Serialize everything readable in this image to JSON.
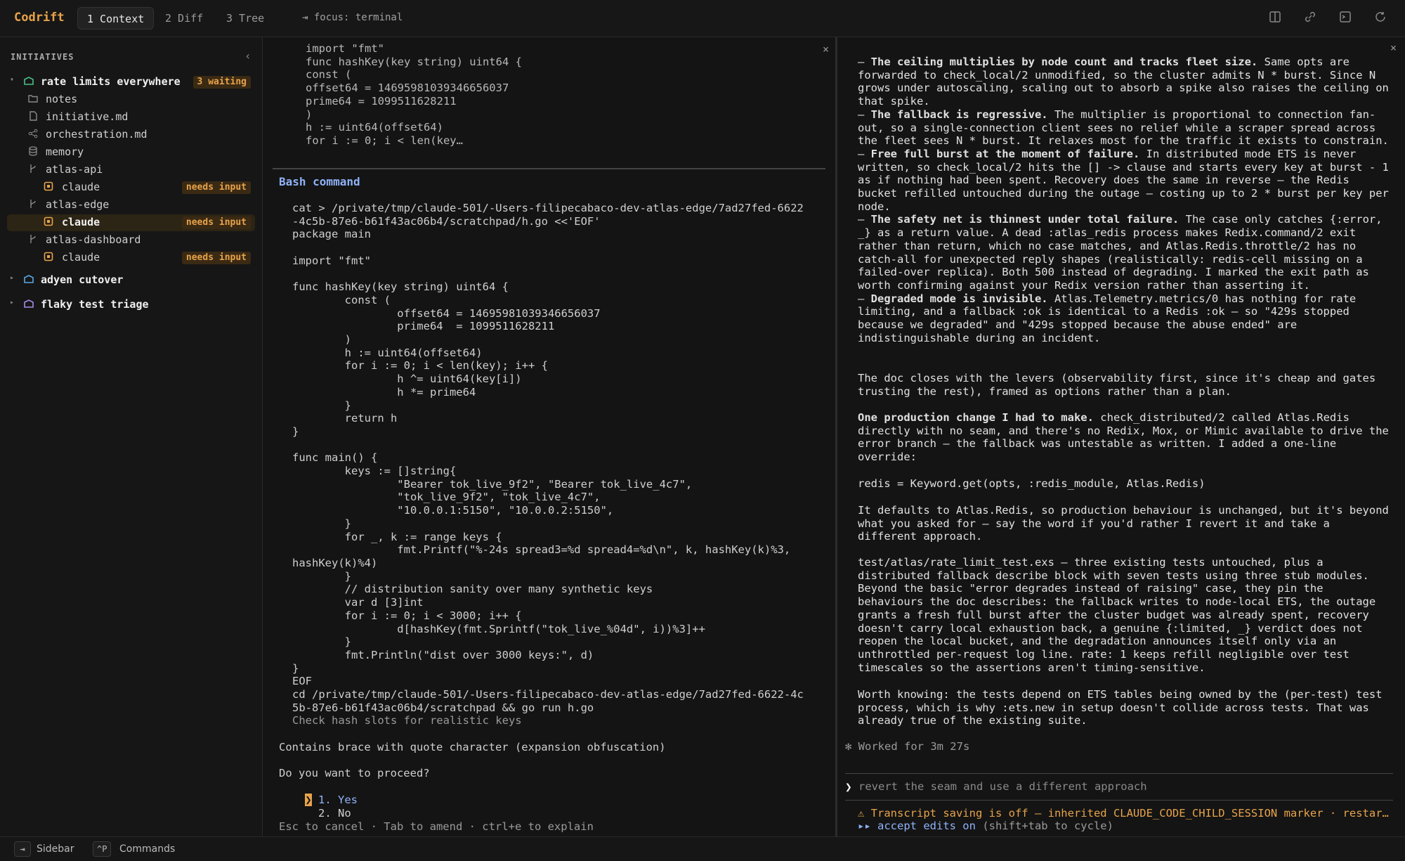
{
  "app": {
    "name": "Codrift"
  },
  "tabs": [
    {
      "label": "1 Context"
    },
    {
      "label": "2 Diff"
    },
    {
      "label": "3 Tree"
    }
  ],
  "focus": {
    "text": "⇥ focus: terminal"
  },
  "top_icons": [
    "split-view-icon",
    "link-icon",
    "terminal-icon",
    "refresh-icon"
  ],
  "sidebar": {
    "title": "INITIATIVES",
    "items": [
      {
        "label": "rate limits everywhere",
        "badge": "3 waiting",
        "icon": "stack-icon",
        "color": "#4cc08a"
      },
      {
        "label": "notes",
        "icon": "folder-icon"
      },
      {
        "label": "initiative.md",
        "icon": "file-icon"
      },
      {
        "label": "orchestration.md",
        "icon": "share-icon"
      },
      {
        "label": "memory",
        "icon": "database-icon"
      },
      {
        "label": "atlas-api",
        "icon": "branch-icon"
      },
      {
        "label": "claude",
        "badge": "needs input",
        "icon": "claude-icon"
      },
      {
        "label": "atlas-edge",
        "icon": "branch-icon"
      },
      {
        "label": "claude",
        "badge": "needs input",
        "icon": "claude-icon"
      },
      {
        "label": "atlas-dashboard",
        "icon": "branch-icon"
      },
      {
        "label": "claude",
        "badge": "needs input",
        "icon": "claude-icon"
      },
      {
        "label": "adyen cutover",
        "icon": "stack-icon",
        "color": "#5aa8e8"
      },
      {
        "label": "flaky test triage",
        "icon": "stack-icon",
        "color": "#a98ae8"
      }
    ]
  },
  "middle": {
    "code_top": "import \"fmt\"\nfunc hashKey(key string) uint64 {\nconst (\noffset64 = 14695981039346656037\nprime64 = 1099511628211\n)\nh := uint64(offset64)\nfor i := 0; i < len(key…",
    "bash_title": "Bash command",
    "command": "cat > /private/tmp/claude-501/-Users-filipecabaco-dev-atlas-edge/7ad27fed-6622\n-4c5b-87e6-b61f43ac06b4/scratchpad/h.go <<'EOF'\npackage main\n\nimport \"fmt\"\n\nfunc hashKey(key string) uint64 {\n        const (\n                offset64 = 14695981039346656037\n                prime64  = 1099511628211\n        )\n        h := uint64(offset64)\n        for i := 0; i < len(key); i++ {\n                h ^= uint64(key[i])\n                h *= prime64\n        }\n        return h\n}\n\nfunc main() {\n        keys := []string{\n                \"Bearer tok_live_9f2\", \"Bearer tok_live_4c7\",\n                \"tok_live_9f2\", \"tok_live_4c7\",\n                \"10.0.0.1:5150\", \"10.0.0.2:5150\",\n        }\n        for _, k := range keys {\n                fmt.Printf(\"%-24s spread3=%d spread4=%d\\n\", k, hashKey(k)%3,\nhashKey(k)%4)\n        }\n        // distribution sanity over many synthetic keys\n        var d [3]int\n        for i := 0; i < 3000; i++ {\n                d[hashKey(fmt.Sprintf(\"tok_live_%04d\", i))%3]++\n        }\n        fmt.Println(\"dist over 3000 keys:\", d)\n}\nEOF\ncd /private/tmp/claude-501/-Users-filipecabaco-dev-atlas-edge/7ad27fed-6622-4c\n5b-87e6-b61f43ac06b4/scratchpad && go run h.go",
    "description": "Check hash slots for realistic keys",
    "warning": "Contains brace with quote character (expansion obfuscation)",
    "question": "Do you want to proceed?",
    "option_yes": "1. Yes",
    "option_no": "2. No",
    "footer": "Esc to cancel · Tab to amend · ctrl+e to explain"
  },
  "right": {
    "bullets": [
      {
        "head": "The ceiling multiplies by node count and tracks fleet size.",
        "text": " Same opts are forwarded to check_local/2 unmodified, so the cluster admits N * burst. Since N grows under autoscaling, scaling out to absorb a spike also raises the ceiling on that spike."
      },
      {
        "head": "The fallback is regressive.",
        "text": " The multiplier is proportional to connection fan-out, so a single-connection client sees no relief while a scraper spread across the fleet sees N * burst. It relaxes most for the traffic it exists to constrain."
      },
      {
        "head": "Free full burst at the moment of failure.",
        "text": " In distributed mode ETS is never written, so check_local/2 hits the [] -> clause and starts every key at burst - 1 as if nothing had been spent. Recovery does the same in reverse — the Redis bucket refilled untouched during the outage — costing up to 2 * burst per key per node."
      },
      {
        "head": "The safety net is thinnest under total failure.",
        "text": " The case only catches {:error, _} as a return value. A dead :atlas_redis process makes Redix.command/2 exit rather than return, which no case matches, and Atlas.Redis.throttle/2 has no catch-all for unexpected reply shapes (realistically: redis-cell missing on a failed-over replica). Both 500 instead of degrading. I marked the exit path as worth confirming against your Redix version rather than asserting it."
      },
      {
        "head": "Degraded mode is invisible.",
        "text": " Atlas.Telemetry.metrics/0 has nothing for rate limiting, and a fallback :ok is identical to a Redis :ok — so \"429s stopped because we degraded\" and \"429s stopped because the abuse ended\" are indistinguishable during an incident."
      }
    ],
    "para_levers": "The doc closes with the levers (observability first, since it's cheap and gates trusting the rest), framed as options rather than a plan.",
    "para_change_head": "One production change I had to make.",
    "para_change": "check_distributed/2 called Atlas.Redis directly with no seam, and there's no Redix, Mox, or Mimic available to drive the error branch — the fallback was untestable as written. I added a one-line override:",
    "code_line": "redis = Keyword.get(opts, :redis_module, Atlas.Redis)",
    "para_defaults": "It defaults to Atlas.Redis, so production behaviour is unchanged, but it's beyond what you asked for — say the word if you'd rather I revert it and take a different approach.",
    "para_tests": "test/atlas/rate_limit_test.exs — three existing tests untouched, plus a distributed fallback describe block with seven tests using three stub modules. Beyond the basic \"error degrades instead of raising\" case, they pin the behaviours the doc describes: the fallback writes to node-local ETS, the outage grants a fresh full burst after the cluster budget was already spent, recovery doesn't carry local exhaustion back, a genuine {:limited, _} verdict does not reopen the local bucket, and the degradation announces itself only via an unthrottled per-request log line. rate: 1 keeps refill negligible over test timescales so the assertions aren't timing-sensitive.",
    "para_worth": "Worth knowing: the tests depend on ETS tables being owned by the (per-test) test process, which is why :ets.new in setup doesn't collide across tests. That was already true of the existing suite.",
    "worked": "✻ Worked for 3m 27s",
    "prompt_placeholder": "revert the seam and use a different approach",
    "warn": "⚠ Transcript saving is off — inherited CLAUDE_CODE_CHILD_SESSION marker · restar…",
    "accept": "▸▸ accept edits on",
    "accept_hint": " (shift+tab to cycle)"
  },
  "bottom": {
    "sidebar_key": "⇥",
    "sidebar_label": "Sidebar",
    "commands_key": "^P",
    "commands_label": "Commands"
  },
  "colors": {
    "accent": "#e8a34a",
    "link": "#8fb2f7",
    "bg": "#141414"
  }
}
